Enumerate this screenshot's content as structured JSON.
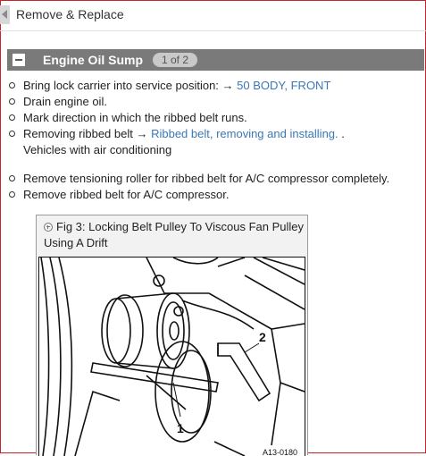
{
  "nav": {
    "title": "Remove & Replace"
  },
  "section": {
    "title": "Engine Oil Sump",
    "badge": "1 of 2"
  },
  "steps_group1": [
    {
      "text": "Bring lock carrier into service position: → ",
      "link": "50 BODY, FRONT",
      "after": ""
    },
    {
      "text": "Drain engine oil.",
      "link": "",
      "after": ""
    },
    {
      "text": "Mark direction in which the ribbed belt runs.",
      "link": "",
      "after": ""
    },
    {
      "text": "Removing ribbed belt → ",
      "link": "Ribbed belt, removing and installing.",
      "after": " .",
      "line2": "Vehicles with air conditioning"
    }
  ],
  "steps_group2": [
    {
      "text": "Remove tensioning roller for ribbed belt for A/C compressor completely."
    },
    {
      "text": "Remove ribbed belt for A/C compressor."
    }
  ],
  "figure": {
    "caption": "Fig 3: Locking Belt Pulley To Viscous Fan Pulley Using A Drift",
    "callout_1": "1",
    "callout_2": "2",
    "part_number": "A13-0180"
  },
  "colors": {
    "frame": "#c8232a",
    "header": "#7a7a7a",
    "link": "#3a78b8"
  }
}
